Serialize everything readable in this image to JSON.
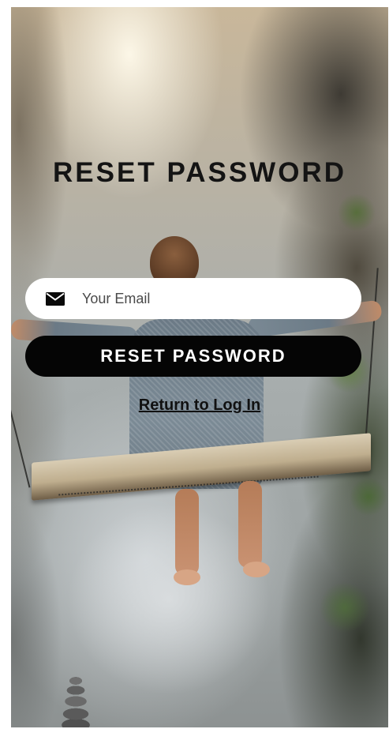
{
  "screen": {
    "title": "RESET PASSWORD",
    "email_field": {
      "placeholder": "Your Email",
      "value": "",
      "icon": "mail-icon"
    },
    "reset_button_label": "RESET PASSWORD",
    "return_link_label": "Return to Log In"
  },
  "background": {
    "description_type": "photo-background",
    "icon": "background-photo"
  },
  "colors": {
    "button_background": "#050505",
    "button_text": "#ffffff",
    "field_background": "#ffffff",
    "title_text": "#141414"
  }
}
